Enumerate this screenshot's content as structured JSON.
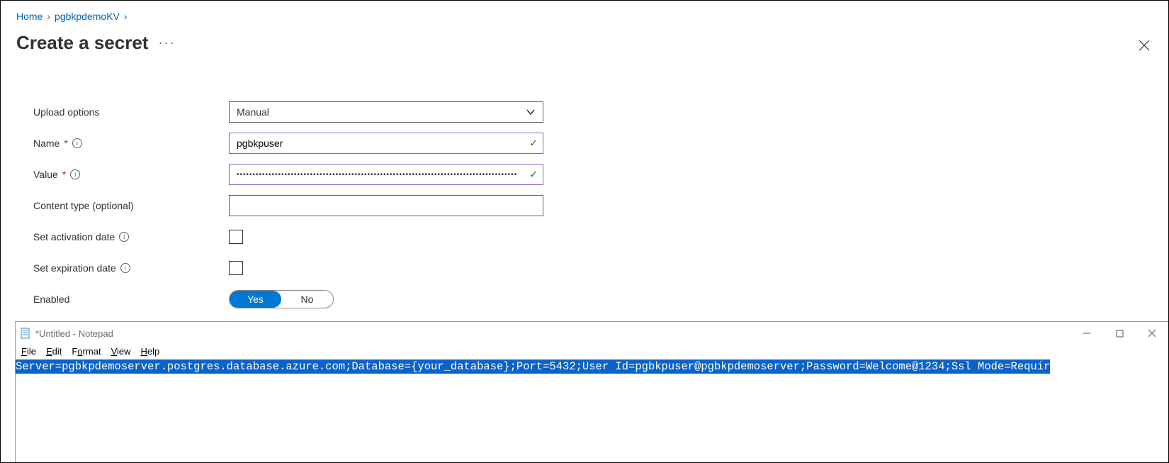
{
  "breadcrumb": {
    "home": "Home",
    "keyvault": "pgbkpdemoKV"
  },
  "page": {
    "title": "Create a secret",
    "more": "···"
  },
  "form": {
    "upload_options_label": "Upload options",
    "upload_options_value": "Manual",
    "name_label": "Name",
    "name_value": "pgbkpuser",
    "value_label": "Value",
    "value_masked": "••••••••••••••••••••••••••••••••••••••••••••••••••••••••••••••••••••••••••••••••••••••••",
    "content_type_label": "Content type (optional)",
    "content_type_value": "",
    "activation_label": "Set activation date",
    "expiration_label": "Set expiration date",
    "enabled_label": "Enabled",
    "enabled_yes": "Yes",
    "enabled_no": "No"
  },
  "notepad": {
    "title": "*Untitled - Notepad",
    "menu": {
      "file": "File",
      "edit": "Edit",
      "format": "Format",
      "view": "View",
      "help": "Help"
    },
    "content": "Server=pgbkpdemoserver.postgres.database.azure.com;Database={your_database};Port=5432;User Id=pgbkpuser@pgbkpdemoserver;Password=Welcome@1234;Ssl Mode=Requir"
  }
}
